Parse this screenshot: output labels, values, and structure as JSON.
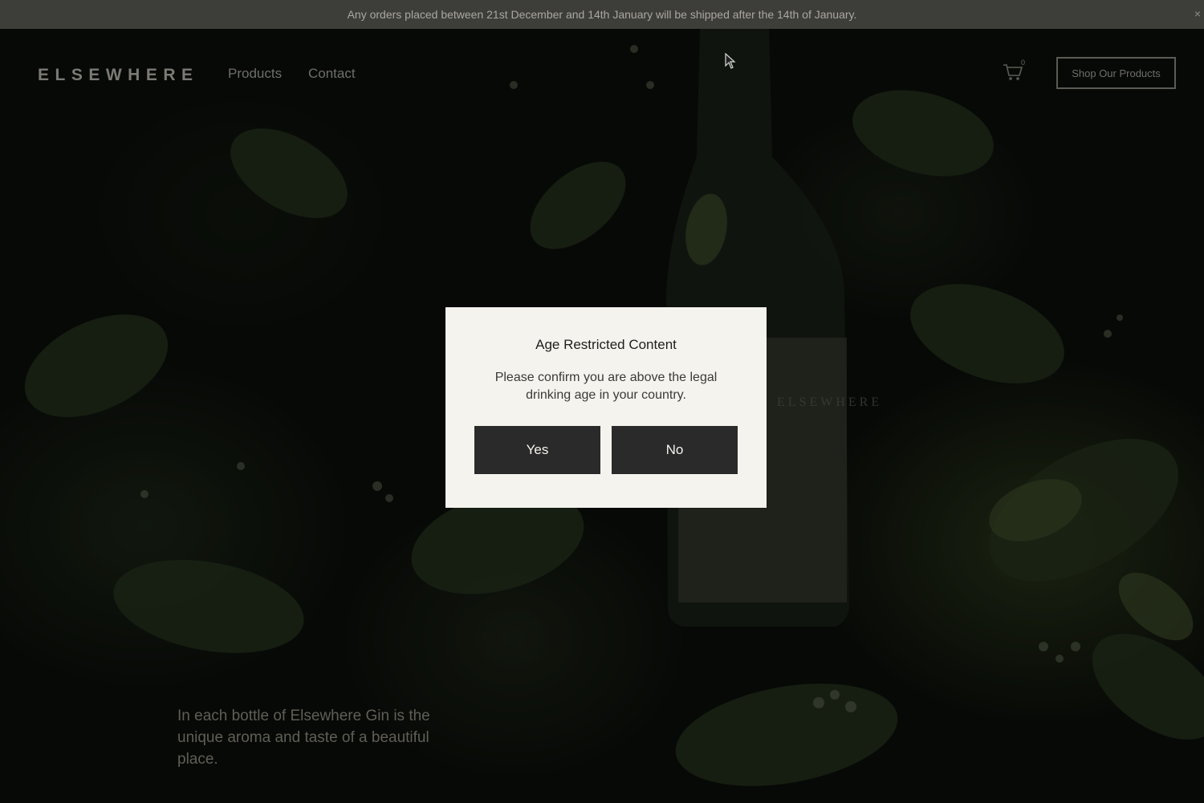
{
  "announcement": {
    "text": "Any orders placed between 21st December and 14th January will be shipped after the 14th of January.",
    "close_icon": "close-icon",
    "close_glyph": "×"
  },
  "header": {
    "logo": "ELSEWHERE",
    "nav": [
      {
        "label": "Products"
      },
      {
        "label": "Contact"
      }
    ],
    "cart_icon": "cart-icon",
    "cart_count": "0",
    "shop_button": "Shop Our Products"
  },
  "hero": {
    "text": "In each bottle of Elsewhere Gin is the unique aroma and taste of a beautiful place.",
    "bottle_label": "ELSEWHERE"
  },
  "modal": {
    "title": "Age Restricted Content",
    "message": "Please confirm you are above the legal drinking age in your country.",
    "yes_label": "Yes",
    "no_label": "No"
  },
  "colors": {
    "modal_bg": "#f5f3ee",
    "button_bg": "#2a2a2a",
    "announcement_bg": "#3d3d3a"
  }
}
